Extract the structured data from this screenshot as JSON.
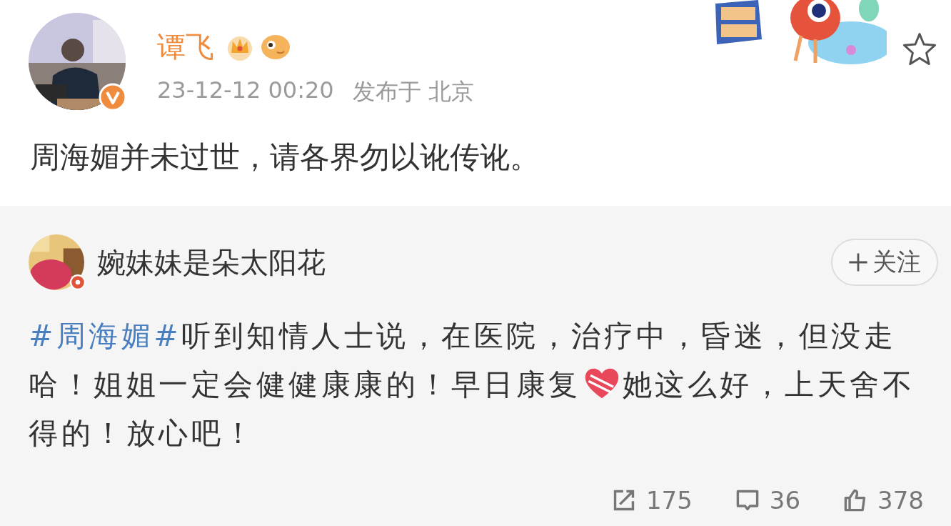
{
  "post": {
    "author": "谭飞",
    "timestamp": "23-12-12 00:20",
    "location": "发布于 北京",
    "text": "周海媚并未过世，请各界勿以讹传讹。",
    "favorited": false
  },
  "retweet": {
    "author": "婉妹妹是朵太阳花",
    "follow_label": "关注",
    "segments": [
      {
        "kind": "hashtag",
        "text": "#周海媚#"
      },
      {
        "kind": "text",
        "text": "听到知情人士说，在医院，治疗中，昏迷，但没走哈！姐姐一定会健健康康的！早日康复"
      },
      {
        "kind": "emoji"
      },
      {
        "kind": "text",
        "text": "她这么好，上天舍不得的！放心吧！"
      }
    ],
    "stats": [
      {
        "kind": "repost",
        "count": "175"
      },
      {
        "kind": "comment",
        "count": "36"
      },
      {
        "kind": "like",
        "count": "378"
      }
    ]
  }
}
